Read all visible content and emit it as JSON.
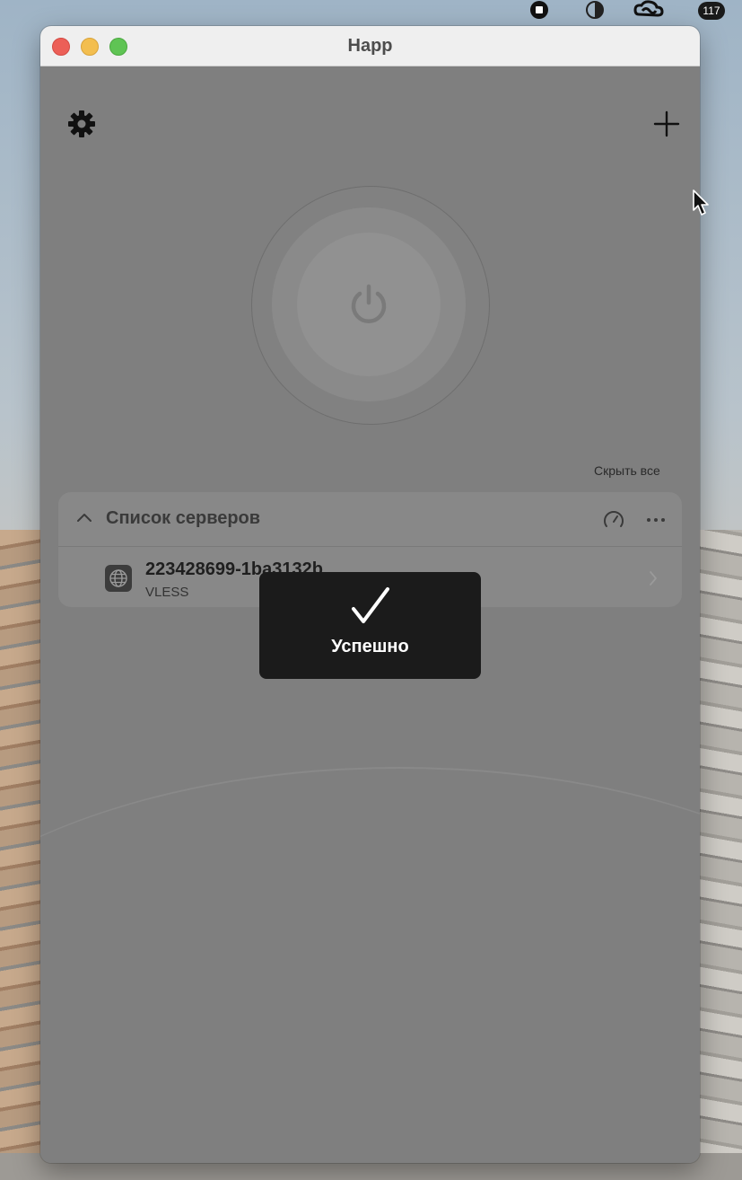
{
  "menubar": {
    "icons": [
      "stop-record-icon",
      "contrast-icon",
      "creative-cloud-icon",
      "notification-badge-icon"
    ],
    "badge_count": "117"
  },
  "window": {
    "title": "Happ"
  },
  "toolbar": {
    "settings_icon": "gear-icon",
    "add_icon": "plus-icon"
  },
  "power": {
    "state": "off",
    "icon": "power-icon"
  },
  "servers": {
    "hide_all_label": "Скрыть все",
    "panel_title": "Список серверов",
    "expanded": true,
    "list": [
      {
        "name": "223428699-1ba3132b",
        "protocol": "VLESS",
        "icon": "globe-icon"
      }
    ]
  },
  "toast": {
    "message": "Успешно",
    "icon": "checkmark-icon"
  },
  "colors": {
    "overlay": "#808080",
    "toast_bg": "#1b1b1b",
    "traffic_red": "#ec5f57",
    "traffic_yellow": "#f3be4f",
    "traffic_green": "#5fc454"
  }
}
